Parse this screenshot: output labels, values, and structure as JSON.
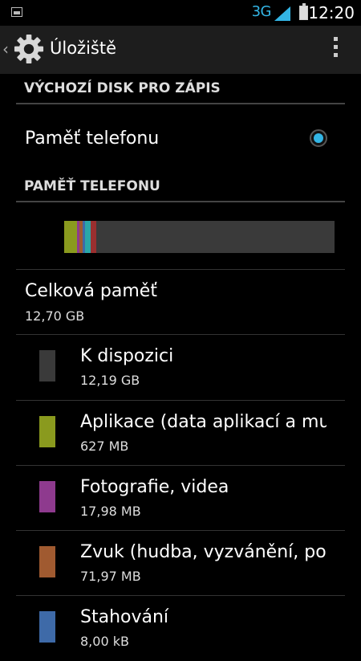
{
  "status_bar": {
    "network": "3G",
    "time": "12:20",
    "icons": [
      "picture-notification-icon",
      "signal-icon",
      "battery-icon"
    ]
  },
  "action_bar": {
    "title": "Úložiště",
    "icons": [
      "back-chevron-icon",
      "gear-icon",
      "overflow-menu-icon"
    ]
  },
  "default_disk": {
    "header": "VÝCHOZÍ DISK PRO ZÁPIS",
    "option_label": "Paměť telefonu",
    "selected": true
  },
  "phone_memory": {
    "header": "PAMĚŤ TELEFONU",
    "usage_segments": [
      {
        "color": "#8a9a1e",
        "fraction": 0.046
      },
      {
        "color": "#8e3a8e",
        "fraction": 0.009
      },
      {
        "color": "#a05a30",
        "fraction": 0.014
      },
      {
        "color": "#3e6aa8",
        "fraction": 0.009
      },
      {
        "color": "#2aa7a7",
        "fraction": 0.02
      },
      {
        "color": "#9a2f2f",
        "fraction": 0.02
      }
    ],
    "total": {
      "label": "Celková paměť",
      "value": "12,70 GB"
    },
    "items": [
      {
        "label": "K dispozici",
        "size": "12,19 GB",
        "color": "#3a3a3a"
      },
      {
        "label": "Aplikace (data aplikací a mu",
        "size": "627 MB",
        "color": "#8a9a1e"
      },
      {
        "label": "Fotografie, videa",
        "size": "17,98 MB",
        "color": "#8e3a8e"
      },
      {
        "label": "Zvuk (hudba, vyzvánění, po",
        "size": "71,97 MB",
        "color": "#a05a30"
      },
      {
        "label": "Stahování",
        "size": "8,00 kB",
        "color": "#3e6aa8"
      }
    ]
  }
}
